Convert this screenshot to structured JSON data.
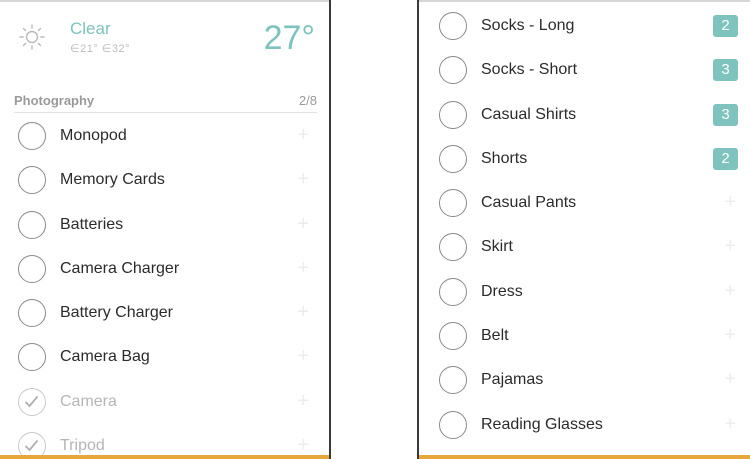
{
  "weather": {
    "condition": "Clear",
    "range": "∈21° ∈32°",
    "temperature": "27°",
    "icon": "sun-icon",
    "accent_color": "#7ec3bd"
  },
  "section": {
    "title": "Photography",
    "count": "2/8"
  },
  "left_items": [
    {
      "label": "Monopod",
      "checked": false
    },
    {
      "label": "Memory Cards",
      "checked": false
    },
    {
      "label": "Batteries",
      "checked": false
    },
    {
      "label": "Camera Charger",
      "checked": false
    },
    {
      "label": "Battery Charger",
      "checked": false
    },
    {
      "label": "Camera Bag",
      "checked": false
    },
    {
      "label": "Camera",
      "checked": true
    },
    {
      "label": "Tripod",
      "checked": true
    }
  ],
  "right_items": [
    {
      "label": "Socks - Long",
      "badge": "2"
    },
    {
      "label": "Socks - Short",
      "badge": "3"
    },
    {
      "label": "Casual Shirts",
      "badge": "3"
    },
    {
      "label": "Shorts",
      "badge": "2"
    },
    {
      "label": "Casual Pants",
      "badge": null
    },
    {
      "label": "Skirt",
      "badge": null
    },
    {
      "label": "Dress",
      "badge": null
    },
    {
      "label": "Belt",
      "badge": null
    },
    {
      "label": "Pajamas",
      "badge": null
    },
    {
      "label": "Reading Glasses",
      "badge": null
    }
  ],
  "icons": {
    "add": "+",
    "check": "check-icon"
  },
  "colors": {
    "badge": "#7ec3bd",
    "bottom_bar": "#e8a73a"
  }
}
